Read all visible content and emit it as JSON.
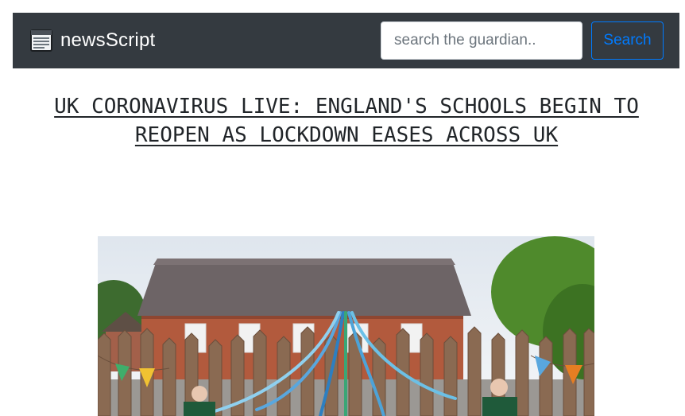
{
  "navbar": {
    "brand_icon": "newspaper-icon",
    "brand_text": "newsScript",
    "search_placeholder": "search the guardian..",
    "search_value": "",
    "search_button_label": "Search"
  },
  "article": {
    "headline": "UK CORONAVIRUS LIVE: ENGLAND'S SCHOOLS BEGIN TO REOPEN AS LOCKDOWN EASES ACROSS UK"
  },
  "colors": {
    "navbar_bg": "#343a40",
    "accent": "#007bff",
    "text": "#212529"
  }
}
